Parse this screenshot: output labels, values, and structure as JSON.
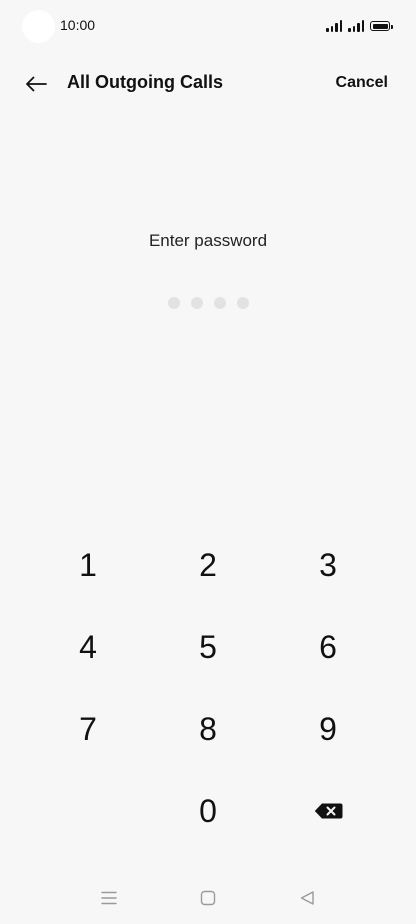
{
  "status_bar": {
    "time": "10:00"
  },
  "header": {
    "back_icon": "arrow-left-icon",
    "title": "All Outgoing Calls",
    "cancel_label": "Cancel"
  },
  "password": {
    "prompt": "Enter password",
    "dots_total": 4,
    "dots_filled": 0
  },
  "keypad": {
    "keys": [
      "1",
      "2",
      "3",
      "4",
      "5",
      "6",
      "7",
      "8",
      "9",
      "",
      "0"
    ],
    "delete_icon": "backspace-icon"
  },
  "nav_bar": {
    "menu_icon": "menu-icon",
    "home_icon": "home-square-icon",
    "back_icon": "back-triangle-icon"
  },
  "colors": {
    "background": "#f7f7f7",
    "text": "#111111",
    "dot_empty": "#e2e2e2",
    "nav_icon": "#9a9a9a"
  }
}
